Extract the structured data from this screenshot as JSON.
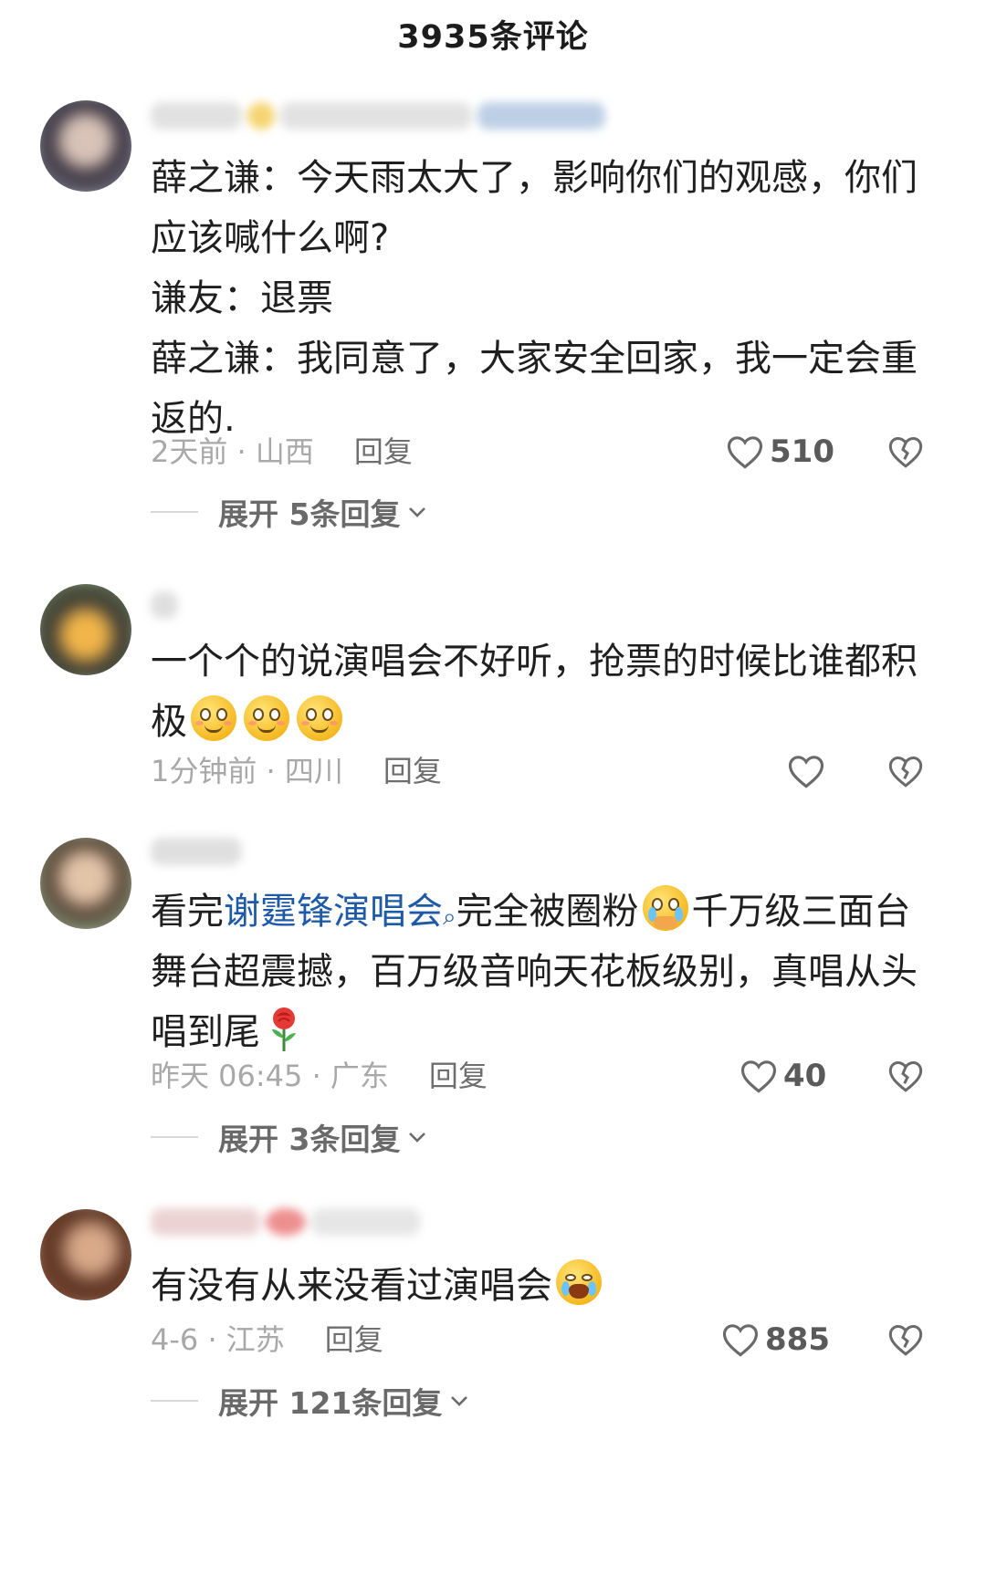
{
  "header": {
    "title": "3935条评论"
  },
  "comments": [
    {
      "lines": [
        "薛之谦：今天雨太大了，影响你们的观感，你们",
        "应该喊什么啊?",
        "谦友：退票",
        "薛之谦：我同意了，大家安全回家，我一定会重",
        "返的."
      ],
      "time_location": "2天前 · 山西",
      "reply_label": "回复",
      "likes": "510",
      "expand_label": "展开 5条回复"
    },
    {
      "text": "一个个的说演唱会不好听，抢票的时候比谁都积",
      "text_line2": "极",
      "emojis": [
        "smile-emoji",
        "smile-emoji",
        "smile-emoji"
      ],
      "time_location": "1分钟前 · 四川",
      "reply_label": "回复",
      "likes": ""
    },
    {
      "prefix": "看完",
      "link": "谢霆锋演唱会",
      "after_link": "完全被圈粉",
      "after_emoji": "千万级三面台",
      "line2": "舞台超震撼，百万级音响天花板级别，真唱从头",
      "line3": "唱到尾",
      "time_location": "昨天 06:45 · 广东",
      "reply_label": "回复",
      "likes": "40",
      "expand_label": "展开 3条回复"
    },
    {
      "text": "有没有从来没看过演唱会",
      "time_location": "4-6 · 江苏",
      "reply_label": "回复",
      "likes": "885",
      "expand_label": "展开 121条回复"
    }
  ],
  "colors": {
    "link": "#1e5aa8",
    "meta": "#a8a8a8",
    "text": "#1f1f1f"
  },
  "icons": [
    "heart-outline-icon",
    "broken-heart-icon",
    "chevron-down-icon",
    "search-icon"
  ]
}
